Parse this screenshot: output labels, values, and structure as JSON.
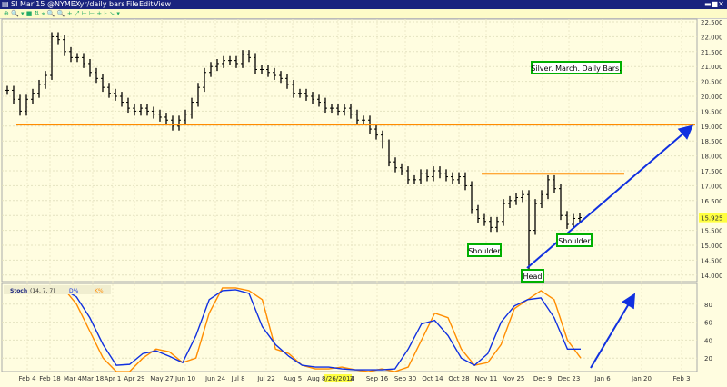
{
  "window": {
    "symbol": "SI Mar'15 @NYMEX",
    "interval": "1 yr/daily bars",
    "menus": [
      "File",
      "Edit",
      "View"
    ]
  },
  "toolbar": {
    "icons": "⊕ 🔍 ▾ ■ ⇅ ⌖ 🔍 🔍 + ⤢ ⊢ ⊢ + ⊦ ↘ ▾"
  },
  "indicator": {
    "name": "Stoch",
    "params": "(14, 7, 7)",
    "d_label": "D%",
    "k_label": "K%"
  },
  "colors": {
    "price": "#000000",
    "orange": "#ff8c00",
    "blue": "#1030e0",
    "box": "#00b000"
  },
  "chart_data": [
    {
      "type": "bar",
      "title": "Silver. March. Daily Bars.",
      "ylim": [
        13.8,
        22.8
      ],
      "yticks": [
        "22.500",
        "22.000",
        "21.500",
        "21.000",
        "20.500",
        "20.000",
        "19.500",
        "19.000",
        "18.500",
        "18.000",
        "17.500",
        "17.000",
        "16.500",
        "16.000",
        "15.500",
        "15.000",
        "14.500",
        "14.000"
      ],
      "last_price": "15.925",
      "closes": [
        20.2,
        19.9,
        19.5,
        19.9,
        20.1,
        20.4,
        20.7,
        22.0,
        21.9,
        21.5,
        21.3,
        21.3,
        21.1,
        20.8,
        20.6,
        20.3,
        20.1,
        20.0,
        19.8,
        19.6,
        19.5,
        19.6,
        19.5,
        19.4,
        19.3,
        19.2,
        19.0,
        19.2,
        19.4,
        19.8,
        20.3,
        20.8,
        21.0,
        21.1,
        21.2,
        21.2,
        21.1,
        21.4,
        21.3,
        20.9,
        20.9,
        20.8,
        20.7,
        20.6,
        20.4,
        20.1,
        20.1,
        20.0,
        19.9,
        19.8,
        19.6,
        19.6,
        19.5,
        19.6,
        19.4,
        19.2,
        19.2,
        18.9,
        18.7,
        18.4,
        17.8,
        17.6,
        17.5,
        17.2,
        17.2,
        17.4,
        17.3,
        17.5,
        17.4,
        17.3,
        17.2,
        17.3,
        17.0,
        16.2,
        15.9,
        15.8,
        15.6,
        15.8,
        16.4,
        16.5,
        16.6,
        16.7,
        15.5,
        16.4,
        16.7,
        17.2,
        16.9,
        16.0,
        15.7,
        15.9,
        15.93
      ],
      "head_low": 14.2,
      "levels": [
        {
          "value": 19.05,
          "color": "orange"
        },
        {
          "value": 17.4,
          "color": "orange"
        }
      ],
      "annotations": {
        "shoulder_left": "Shoulder",
        "head": "Head",
        "shoulder_right": "Shoulder"
      }
    },
    {
      "type": "line",
      "title": "Stoch (14, 7, 7)",
      "ylim": [
        0,
        100
      ],
      "yticks": [
        "80",
        "60",
        "40",
        "20"
      ],
      "xticks": [
        "Feb 4",
        "Feb 18",
        "Mar 4",
        "Mar 18",
        "Apr 1",
        "Apr 29",
        "May 27",
        "Jun 10",
        "Jun 24",
        "Jul 8",
        "Jul 22",
        "Aug 5",
        "Aug",
        "8/26/2014",
        "2",
        "Sep 16",
        "Sep 30",
        "Oct 14",
        "Oct 28",
        "Nov 11",
        "Nov 25",
        "Dec 9",
        "Dec 23",
        "Jan 6",
        "Jan 20",
        "Feb 3"
      ],
      "series": [
        {
          "name": "K%",
          "color": "orange",
          "values": [
            95,
            98,
            80,
            50,
            20,
            5,
            5,
            20,
            30,
            27,
            15,
            20,
            70,
            98,
            98,
            95,
            85,
            30,
            25,
            12,
            8,
            8,
            10,
            7,
            5,
            8,
            5,
            10,
            40,
            70,
            65,
            30,
            12,
            15,
            35,
            75,
            85,
            95,
            85,
            40,
            20
          ]
        },
        {
          "name": "D%",
          "color": "blue",
          "values": [
            96,
            97,
            88,
            65,
            35,
            12,
            13,
            25,
            28,
            22,
            15,
            45,
            85,
            95,
            96,
            92,
            55,
            35,
            22,
            12,
            10,
            10,
            8,
            7,
            7,
            7,
            8,
            30,
            58,
            62,
            45,
            20,
            12,
            25,
            60,
            78,
            85,
            87,
            65,
            30,
            30
          ]
        }
      ]
    }
  ]
}
